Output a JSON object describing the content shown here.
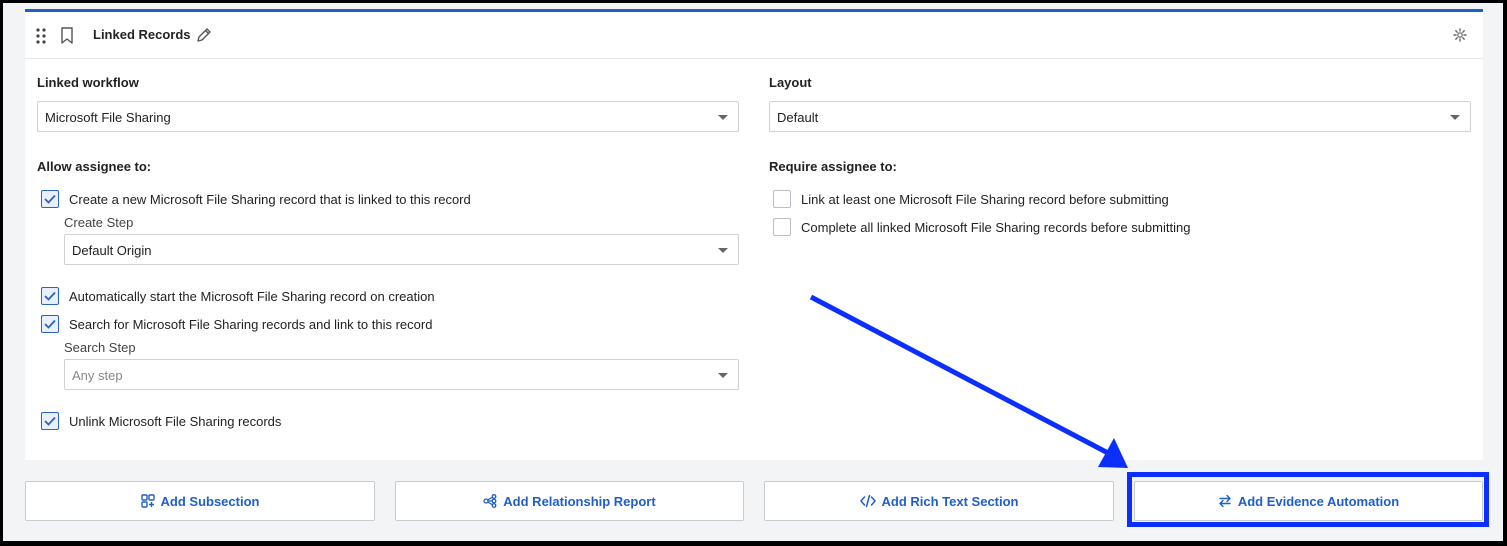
{
  "header": {
    "title": "Linked Records"
  },
  "left": {
    "linked_workflow_label": "Linked workflow",
    "linked_workflow_value": "Microsoft File Sharing",
    "allow_label": "Allow assignee to:",
    "create_record": {
      "label": "Create a new Microsoft File Sharing record that is linked to this record",
      "checked": true
    },
    "create_step_label": "Create Step",
    "create_step_value": "Default Origin",
    "auto_start": {
      "label": "Automatically start the Microsoft File Sharing record on creation",
      "checked": true
    },
    "search_link": {
      "label": "Search for Microsoft File Sharing records and link to this record",
      "checked": true
    },
    "search_step_label": "Search Step",
    "search_step_placeholder": "Any step",
    "unlink": {
      "label": "Unlink Microsoft File Sharing records",
      "checked": true
    }
  },
  "right": {
    "layout_label": "Layout",
    "layout_value": "Default",
    "require_label": "Require assignee to:",
    "link_one": {
      "label": "Link at least one Microsoft File Sharing record before submitting",
      "checked": false
    },
    "complete_all": {
      "label": "Complete all linked Microsoft File Sharing records before submitting",
      "checked": false
    }
  },
  "actions": {
    "add_subsection": "Add Subsection",
    "add_relationship_report": "Add Relationship Report",
    "add_rich_text_section": "Add Rich Text Section",
    "add_evidence_automation": "Add Evidence Automation"
  },
  "colors": {
    "accent": "#1f5fc7",
    "annotation": "#0a2fff"
  },
  "icons": [
    "drag-handle-icon",
    "bookmark-icon",
    "pencil-icon",
    "gear-icon",
    "chevron-down-icon",
    "checkmark-icon",
    "subsection-icon",
    "relationship-icon",
    "code-icon",
    "swap-icon"
  ]
}
